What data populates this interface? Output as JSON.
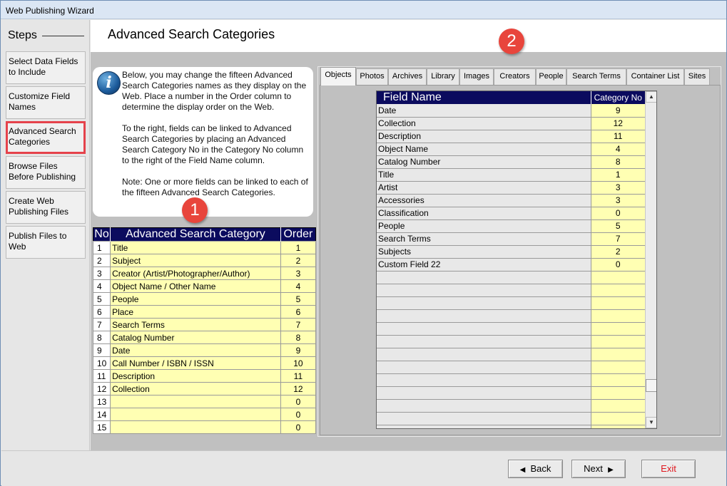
{
  "window": {
    "title": "Web Publishing Wizard"
  },
  "steps": {
    "title": "Steps",
    "items": [
      {
        "label": "Select Data Fields to Include",
        "name": "step-select-data-fields"
      },
      {
        "label": "Customize Field Names",
        "name": "step-customize-field-names"
      },
      {
        "label": "Advanced Search Categories",
        "name": "step-advanced-search-categories",
        "active": true
      },
      {
        "label": "Browse Files Before Publishing",
        "name": "step-browse-files"
      },
      {
        "label": "Create Web Publishing Files",
        "name": "step-create-web-files"
      },
      {
        "label": "Publish Files to Web",
        "name": "step-publish-files"
      }
    ]
  },
  "page": {
    "title": "Advanced Search Categories"
  },
  "info": {
    "icon": "info-icon",
    "icon_glyph": "i",
    "paragraphs": [
      "Below, you may change the fifteen Advanced Search Categories names as they display on the Web.    Place a number in the Order column to determine the display order on the Web.",
      "To the right, fields can be linked to Advanced Search Categories by placing an Advanced Search Category No in the Category No column to the right of the Field Name column.",
      "Note: One or more fields can be linked to each of the fifteen Advanced Search Categories."
    ]
  },
  "badges": {
    "one": "1",
    "two": "2"
  },
  "categories_table": {
    "headers": {
      "no": "No",
      "category": "Advanced Search Category",
      "order": "Order"
    },
    "rows": [
      {
        "no": "1",
        "category": "Title",
        "order": "1"
      },
      {
        "no": "2",
        "category": "Subject",
        "order": "2"
      },
      {
        "no": "3",
        "category": "Creator (Artist/Photographer/Author)",
        "order": "3"
      },
      {
        "no": "4",
        "category": "Object Name / Other Name",
        "order": "4"
      },
      {
        "no": "5",
        "category": "People",
        "order": "5"
      },
      {
        "no": "6",
        "category": "Place",
        "order": "6"
      },
      {
        "no": "7",
        "category": "Search Terms",
        "order": "7"
      },
      {
        "no": "8",
        "category": "Catalog Number",
        "order": "8"
      },
      {
        "no": "9",
        "category": "Date",
        "order": "9"
      },
      {
        "no": "10",
        "category": "Call Number / ISBN / ISSN",
        "order": "10"
      },
      {
        "no": "11",
        "category": "Description",
        "order": "11"
      },
      {
        "no": "12",
        "category": "Collection",
        "order": "12"
      },
      {
        "no": "13",
        "category": "",
        "order": "0"
      },
      {
        "no": "14",
        "category": "",
        "order": "0"
      },
      {
        "no": "15",
        "category": "",
        "order": "0"
      }
    ]
  },
  "tabs": [
    {
      "label": "Objects",
      "active": true
    },
    {
      "label": "Photos"
    },
    {
      "label": "Archives"
    },
    {
      "label": "Library"
    },
    {
      "label": "Images"
    },
    {
      "label": "Creators"
    },
    {
      "label": "People"
    },
    {
      "label": "Search Terms"
    },
    {
      "label": "Container List"
    },
    {
      "label": "Sites"
    }
  ],
  "fields_table": {
    "headers": {
      "field_name": "Field Name",
      "category_no": "Category No"
    },
    "rows": [
      {
        "field": "Date",
        "cat": "9"
      },
      {
        "field": "Collection",
        "cat": "12"
      },
      {
        "field": "Description",
        "cat": "11"
      },
      {
        "field": "Object Name",
        "cat": "4"
      },
      {
        "field": "Catalog Number",
        "cat": "8"
      },
      {
        "field": "Title",
        "cat": "1"
      },
      {
        "field": "Artist",
        "cat": "3"
      },
      {
        "field": "Accessories",
        "cat": "3"
      },
      {
        "field": "Classification",
        "cat": "0"
      },
      {
        "field": "People",
        "cat": "5"
      },
      {
        "field": "Search Terms",
        "cat": "7"
      },
      {
        "field": "Subjects",
        "cat": "2"
      },
      {
        "field": "Custom Field 22",
        "cat": "0"
      }
    ],
    "empty_rows": 13
  },
  "footer": {
    "back_label": "Back",
    "next_label": "Next",
    "exit_label": "Exit"
  }
}
